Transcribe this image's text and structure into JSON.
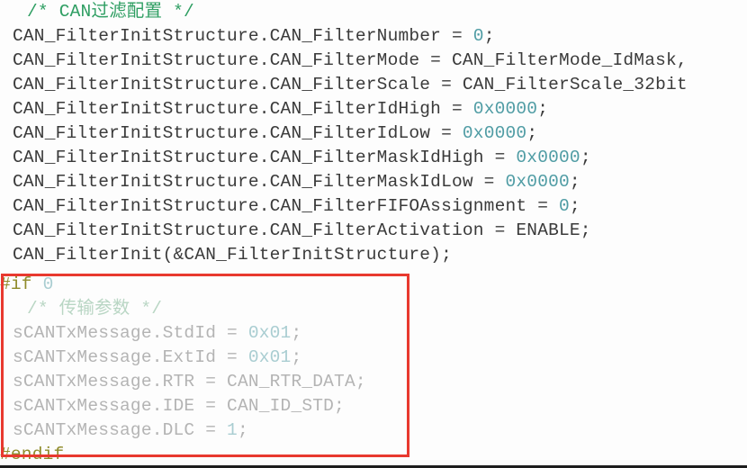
{
  "editor": {
    "background_color": "#fdfdfd",
    "default_text_color": "#3a3a3a",
    "comment_color": "#2e9e62",
    "number_color": "#4f9ca4",
    "preprocessor_color": "#8f8b2a",
    "inactive_text_color": "#b4b4b4",
    "annotation_color": "#e8392f"
  },
  "active_code": {
    "lines": [
      {
        "indent": 2,
        "tokens": [
          {
            "text": "/* CAN过滤配置 */",
            "type": "comment"
          }
        ]
      },
      {
        "indent": 1,
        "tokens": [
          {
            "text": "CAN_FilterInitStructure.CAN_FilterNumber = ",
            "type": "plain"
          },
          {
            "text": "0",
            "type": "number"
          },
          {
            "text": ";",
            "type": "plain"
          }
        ]
      },
      {
        "indent": 1,
        "tokens": [
          {
            "text": "CAN_FilterInitStructure.CAN_FilterMode = CAN_FilterMode_IdMask,",
            "type": "plain"
          }
        ]
      },
      {
        "indent": 1,
        "tokens": [
          {
            "text": "CAN_FilterInitStructure.CAN_FilterScale = CAN_FilterScale_32bit",
            "type": "plain"
          }
        ]
      },
      {
        "indent": 1,
        "tokens": [
          {
            "text": "CAN_FilterInitStructure.CAN_FilterIdHigh = ",
            "type": "plain"
          },
          {
            "text": "0x0000",
            "type": "number"
          },
          {
            "text": ";",
            "type": "plain"
          }
        ]
      },
      {
        "indent": 1,
        "tokens": [
          {
            "text": "CAN_FilterInitStructure.CAN_FilterIdLow = ",
            "type": "plain"
          },
          {
            "text": "0x0000",
            "type": "number"
          },
          {
            "text": ";",
            "type": "plain"
          }
        ]
      },
      {
        "indent": 1,
        "tokens": [
          {
            "text": "CAN_FilterInitStructure.CAN_FilterMaskIdHigh = ",
            "type": "plain"
          },
          {
            "text": "0x0000",
            "type": "number"
          },
          {
            "text": ";",
            "type": "plain"
          }
        ]
      },
      {
        "indent": 1,
        "tokens": [
          {
            "text": "CAN_FilterInitStructure.CAN_FilterMaskIdLow = ",
            "type": "plain"
          },
          {
            "text": "0x0000",
            "type": "number"
          },
          {
            "text": ";",
            "type": "plain"
          }
        ]
      },
      {
        "indent": 1,
        "tokens": [
          {
            "text": "CAN_FilterInitStructure.CAN_FilterFIFOAssignment = ",
            "type": "plain"
          },
          {
            "text": "0",
            "type": "number"
          },
          {
            "text": ";",
            "type": "plain"
          }
        ]
      },
      {
        "indent": 1,
        "tokens": [
          {
            "text": "CAN_FilterInitStructure.CAN_FilterActivation = ENABLE;",
            "type": "plain"
          }
        ]
      },
      {
        "indent": 1,
        "tokens": [
          {
            "text": "CAN_FilterInit(&CAN_FilterInitStructure);",
            "type": "plain"
          }
        ]
      }
    ]
  },
  "inactive_code": {
    "lines": [
      {
        "indent": 0,
        "tokens": [
          {
            "text": "#if ",
            "type": "pp"
          },
          {
            "text": "0",
            "type": "number"
          }
        ]
      },
      {
        "indent": 2,
        "tokens": [
          {
            "text": "/* 传输参数 */",
            "type": "comment"
          }
        ]
      },
      {
        "indent": 1,
        "tokens": [
          {
            "text": "sCANTxMessage.StdId = ",
            "type": "plain"
          },
          {
            "text": "0x01",
            "type": "number"
          },
          {
            "text": ";",
            "type": "plain"
          }
        ]
      },
      {
        "indent": 1,
        "tokens": [
          {
            "text": "sCANTxMessage.ExtId = ",
            "type": "plain"
          },
          {
            "text": "0x01",
            "type": "number"
          },
          {
            "text": ";",
            "type": "plain"
          }
        ]
      },
      {
        "indent": 1,
        "tokens": [
          {
            "text": "sCANTxMessage.RTR = CAN_RTR_DATA;",
            "type": "plain"
          }
        ]
      },
      {
        "indent": 1,
        "tokens": [
          {
            "text": "sCANTxMessage.IDE = CAN_ID_STD;",
            "type": "plain"
          }
        ]
      },
      {
        "indent": 1,
        "tokens": [
          {
            "text": "sCANTxMessage.DLC = ",
            "type": "plain"
          },
          {
            "text": "1",
            "type": "number"
          },
          {
            "text": ";",
            "type": "plain"
          }
        ]
      },
      {
        "indent": 0,
        "tokens": [
          {
            "text": "#endif",
            "type": "pp"
          }
        ]
      }
    ]
  },
  "annotation": {
    "shape": "rectangle",
    "color": "#e8392f",
    "label": "highlighted-disabled-block"
  }
}
